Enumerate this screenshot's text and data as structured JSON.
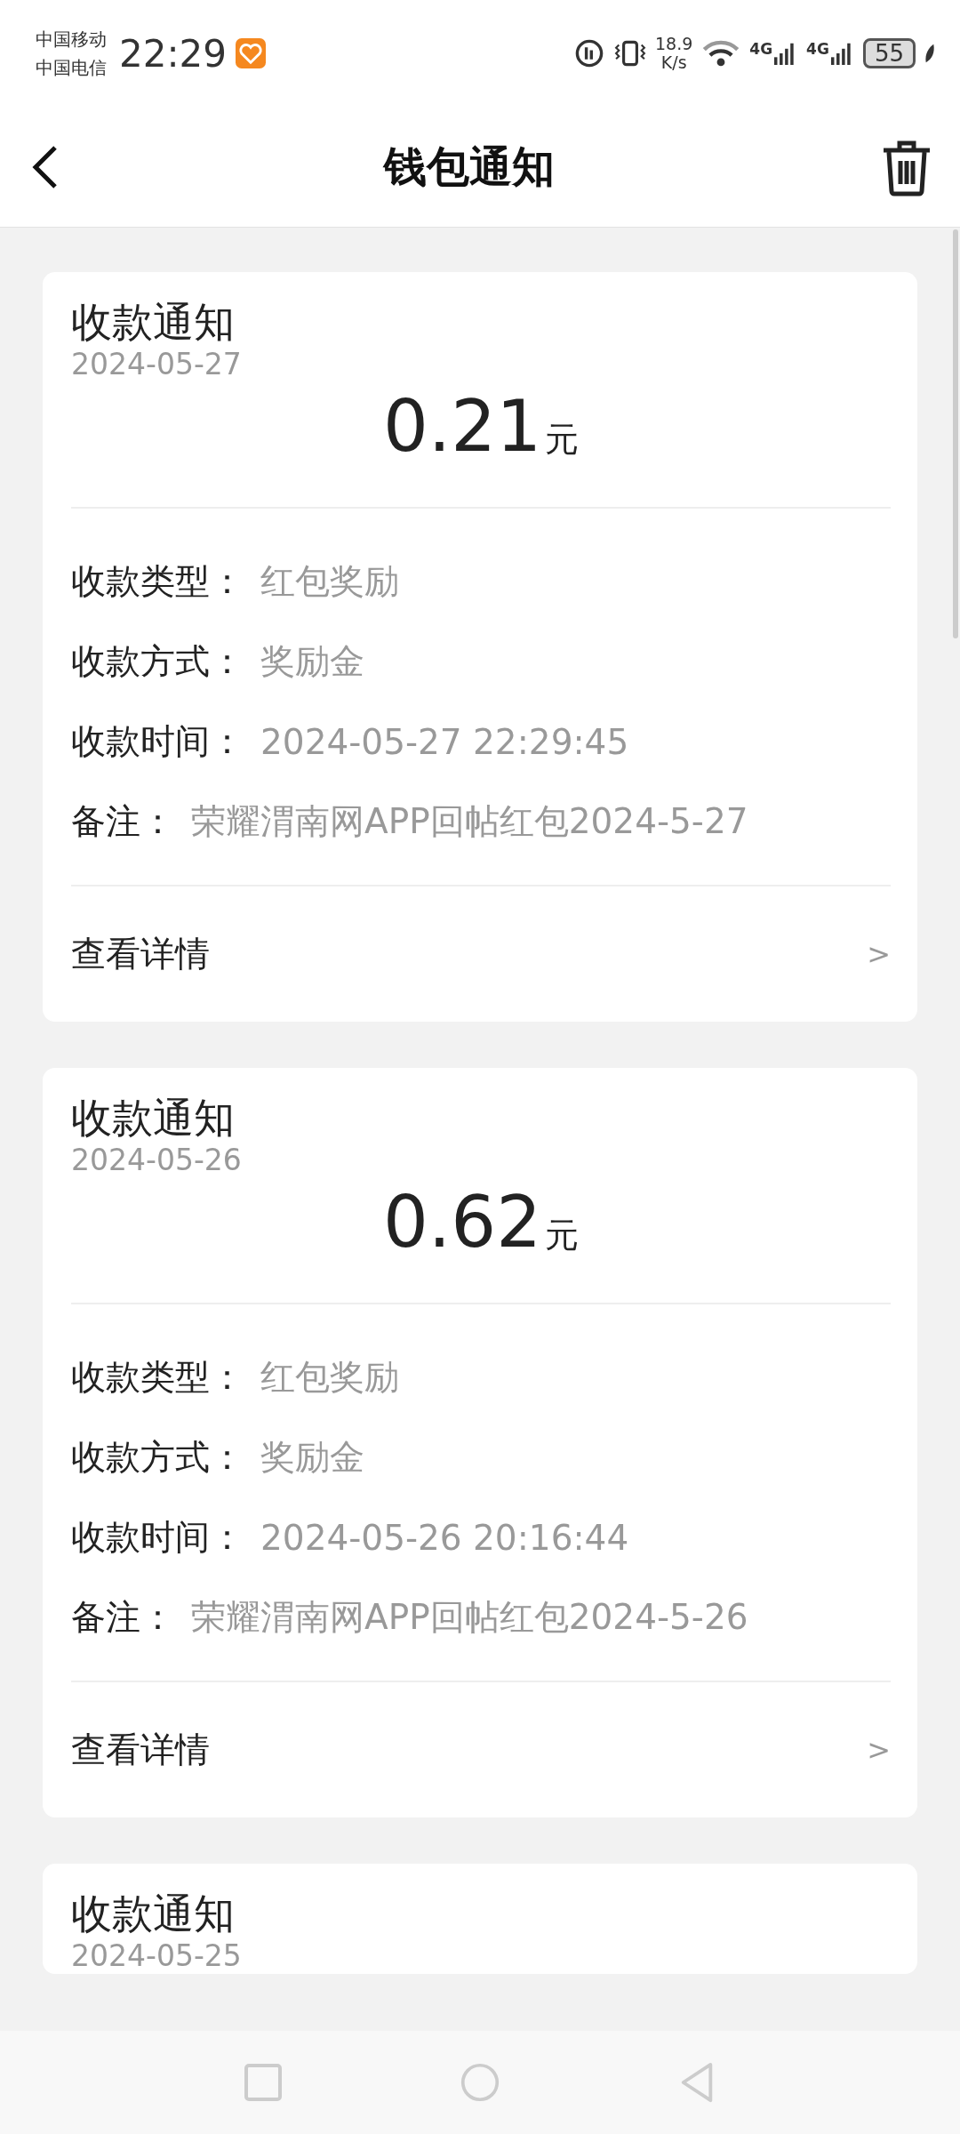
{
  "status_bar": {
    "carriers": [
      "中国移动",
      "中国电信"
    ],
    "time": "22:29",
    "net_speed": [
      "18.9",
      "K/s"
    ],
    "signal_labels": [
      "4G",
      "4G"
    ],
    "battery": "55"
  },
  "header": {
    "title": "钱包通知"
  },
  "notices": [
    {
      "title": "收款通知",
      "date": "2024-05-27",
      "amount": "0.21",
      "unit": "元",
      "rows": [
        {
          "label": "收款类型：",
          "value": "红包奖励"
        },
        {
          "label": "收款方式：",
          "value": "奖励金"
        },
        {
          "label": "收款时间：",
          "value": "2024-05-27 22:29:45"
        },
        {
          "label": "备注：",
          "value": "荣耀渭南网APP回帖红包2024-5-27"
        }
      ],
      "link": "查看详情",
      "chevron": ">"
    },
    {
      "title": "收款通知",
      "date": "2024-05-26",
      "amount": "0.62",
      "unit": "元",
      "rows": [
        {
          "label": "收款类型：",
          "value": "红包奖励"
        },
        {
          "label": "收款方式：",
          "value": "奖励金"
        },
        {
          "label": "收款时间：",
          "value": "2024-05-26 20:16:44"
        },
        {
          "label": "备注：",
          "value": "荣耀渭南网APP回帖红包2024-5-26"
        }
      ],
      "link": "查看详情",
      "chevron": ">"
    },
    {
      "title": "收款通知",
      "date": "2024-05-25"
    }
  ]
}
